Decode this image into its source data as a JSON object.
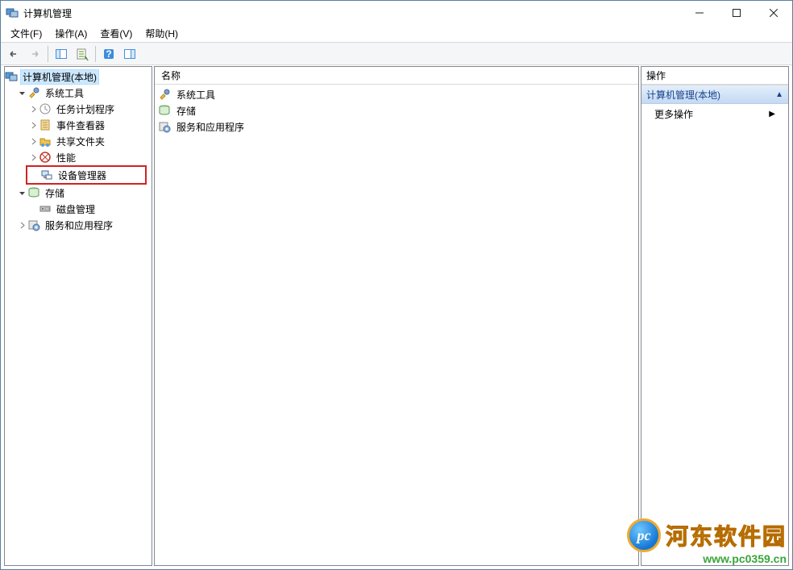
{
  "window": {
    "title": "计算机管理"
  },
  "menubar": {
    "file": "文件(F)",
    "action": "操作(A)",
    "view": "查看(V)",
    "help": "帮助(H)"
  },
  "list_header": "名称",
  "tree": {
    "root": "计算机管理(本地)",
    "system_tools": "系统工具",
    "task_scheduler": "任务计划程序",
    "event_viewer": "事件查看器",
    "shared_folders": "共享文件夹",
    "performance": "性能",
    "device_manager": "设备管理器",
    "storage": "存储",
    "disk_management": "磁盘管理",
    "services_apps": "服务和应用程序"
  },
  "list": {
    "system_tools": "系统工具",
    "storage": "存储",
    "services_apps": "服务和应用程序"
  },
  "actions": {
    "header": "操作",
    "section_title": "计算机管理(本地)",
    "more_actions": "更多操作"
  },
  "watermark": {
    "title": "河东软件园",
    "url": "www.pc0359.cn",
    "badge": "pc"
  }
}
